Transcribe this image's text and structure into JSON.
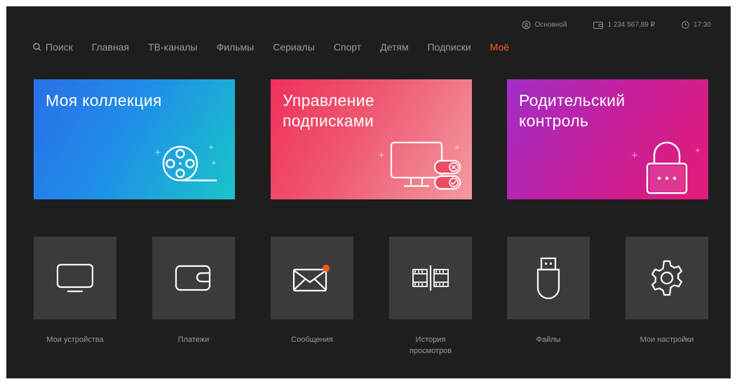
{
  "status": {
    "profile": "Основной",
    "balance": "1 234 567,89 ₽",
    "time": "17:30"
  },
  "nav": {
    "search": "Поиск",
    "items": [
      "Главная",
      "ТВ-каналы",
      "Фильмы",
      "Сериалы",
      "Спорт",
      "Детям",
      "Подписки",
      "Моё"
    ],
    "active": "Моё"
  },
  "cards": {
    "collection": "Моя коллекция",
    "subscriptions": "Управление подписками",
    "parental": "Родительский контроль"
  },
  "tiles": {
    "devices": "Мои устройства",
    "payments": "Платежи",
    "messages": "Сообщения",
    "history": "История просмотров",
    "files": "Файлы",
    "settings": "Мои настройки"
  },
  "colors": {
    "background": "#1e1e1e",
    "tile": "#3b3b3b",
    "accent": "#ff5a1f",
    "muted_text": "#9a9a9a"
  },
  "icons": {
    "profile": "profile-icon",
    "balance": "wallet-icon",
    "clock": "clock-icon",
    "search": "search-icon",
    "collection": "film-reel-icon",
    "subscriptions": "monitor-toggles-icon",
    "parental": "padlock-icon",
    "devices": "tv-icon",
    "payments": "wallet-icon",
    "messages": "envelope-icon",
    "history": "film-strip-icon",
    "files": "usb-drive-icon",
    "settings": "gear-icon"
  }
}
